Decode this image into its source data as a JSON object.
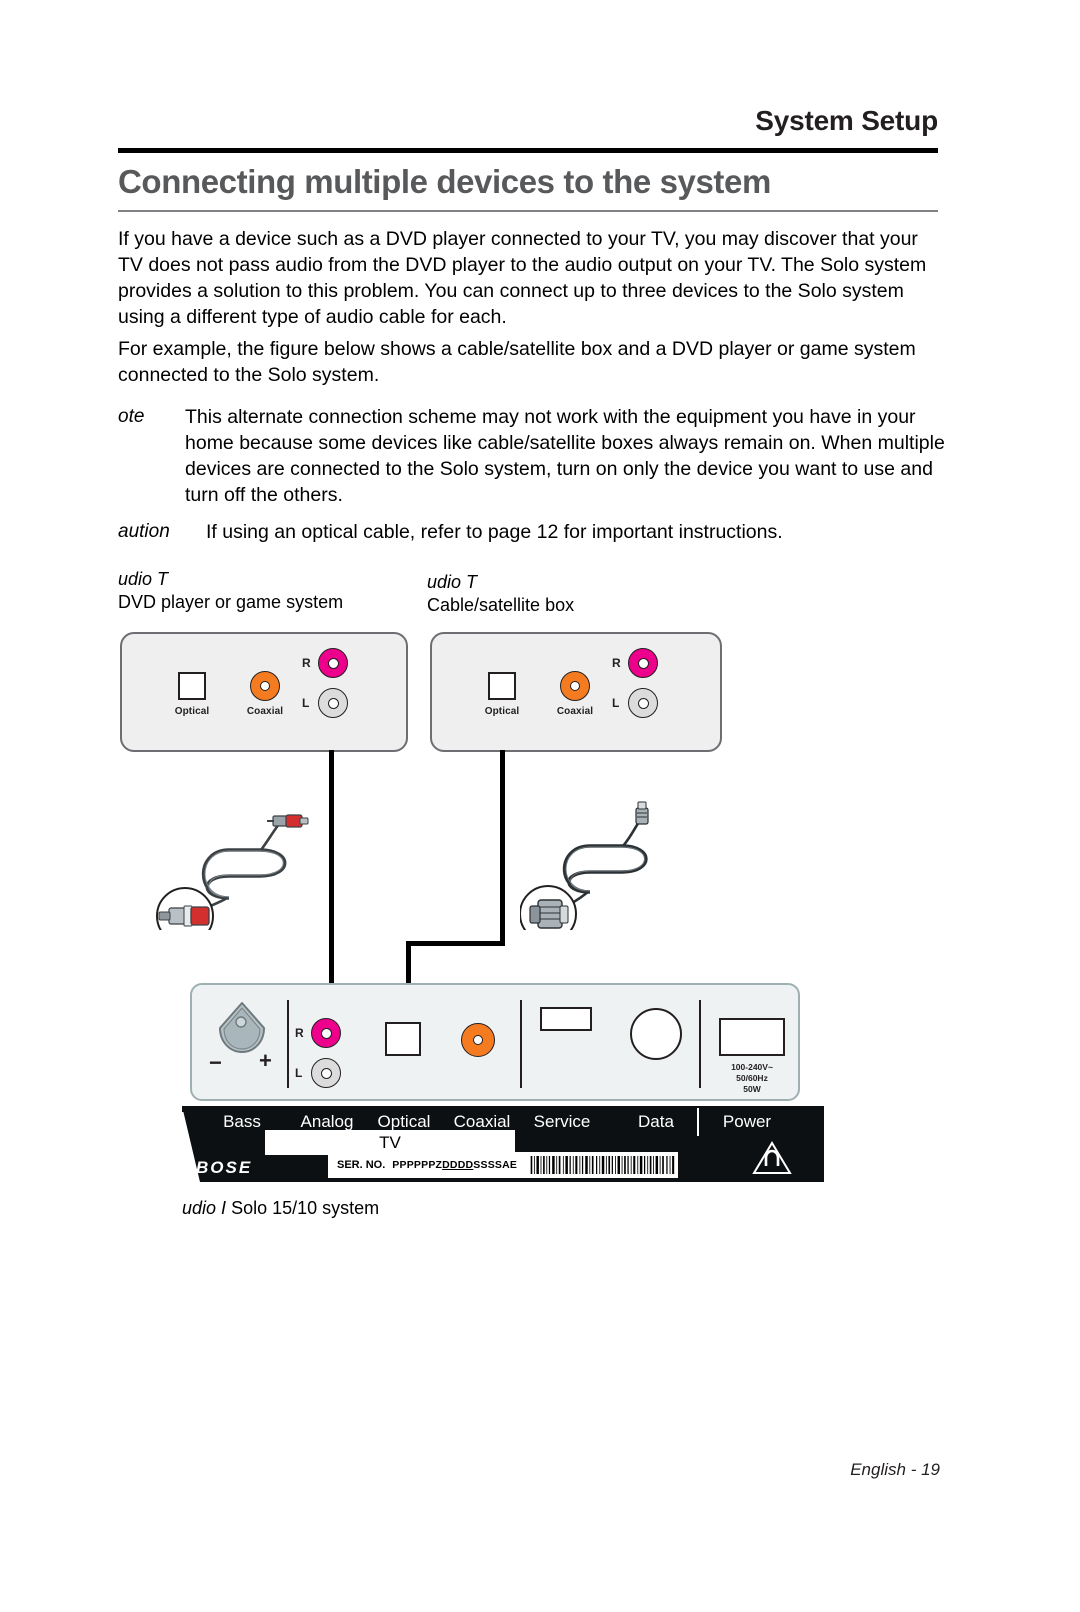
{
  "header": {
    "running_head": "System Setup",
    "chapter_title": "Connecting multiple devices to the system"
  },
  "body": {
    "paragraph_1": "If you have a device such as a DVD player connected to your TV, you may discover that your TV does not pass audio from the DVD player to the audio output on your TV. The Solo system provides a solution to this problem. You can connect up to three devices to the Solo system using a different type of audio cable for each.",
    "paragraph_2": "For example, the figure below shows a cable/satellite box and a DVD player or game system connected to the Solo system.",
    "note_tag": "ote",
    "note_text": "This alternate connection scheme may not work with the equipment you have in your home because some devices like cable/satellite boxes always remain on. When multiple devices are connected to the Solo system, turn on only the device you want to use and turn off the others.",
    "caution_tag": "aution",
    "caution_text": "If using an optical cable, refer to page 12 for important instructions."
  },
  "figure": {
    "dvd_label_italic": "udio T",
    "dvd_label": "DVD player or game system",
    "cable_label_italic": "udio T",
    "cable_label": "Cable/satellite box",
    "solo_caption_italic": "udio I",
    "solo_caption": "Solo 15/10 system",
    "device_jacks": {
      "optical": "Optical",
      "coaxial": "Coaxial",
      "right": "R",
      "left": "L"
    },
    "main_unit": {
      "bass_minus": "−",
      "bass_plus": "+",
      "right": "R",
      "left": "L",
      "power_rating_line_1": "100-240V~",
      "power_rating_line_2": "50/60Hz",
      "power_rating_line_3": "50W",
      "band_labels": [
        "Bass",
        "Analog",
        "Optical",
        "Coaxial",
        "Service",
        "Data",
        "Power"
      ],
      "tv_label": "TV",
      "brand": "BOSE",
      "serial_label": "SER. NO.",
      "serial_prefix": "PPPPPPZ",
      "serial_underlined": "DDDD",
      "serial_suffix": "SSSSAE"
    }
  },
  "footer": {
    "text": "English - 19"
  },
  "colors": {
    "rca_right": "#ec008c",
    "rca_left": "#dcdcdc",
    "coaxial": "#f47b20",
    "title_gray": "#58595b",
    "panel": "#eef2f2",
    "device_box": "#efefef"
  }
}
